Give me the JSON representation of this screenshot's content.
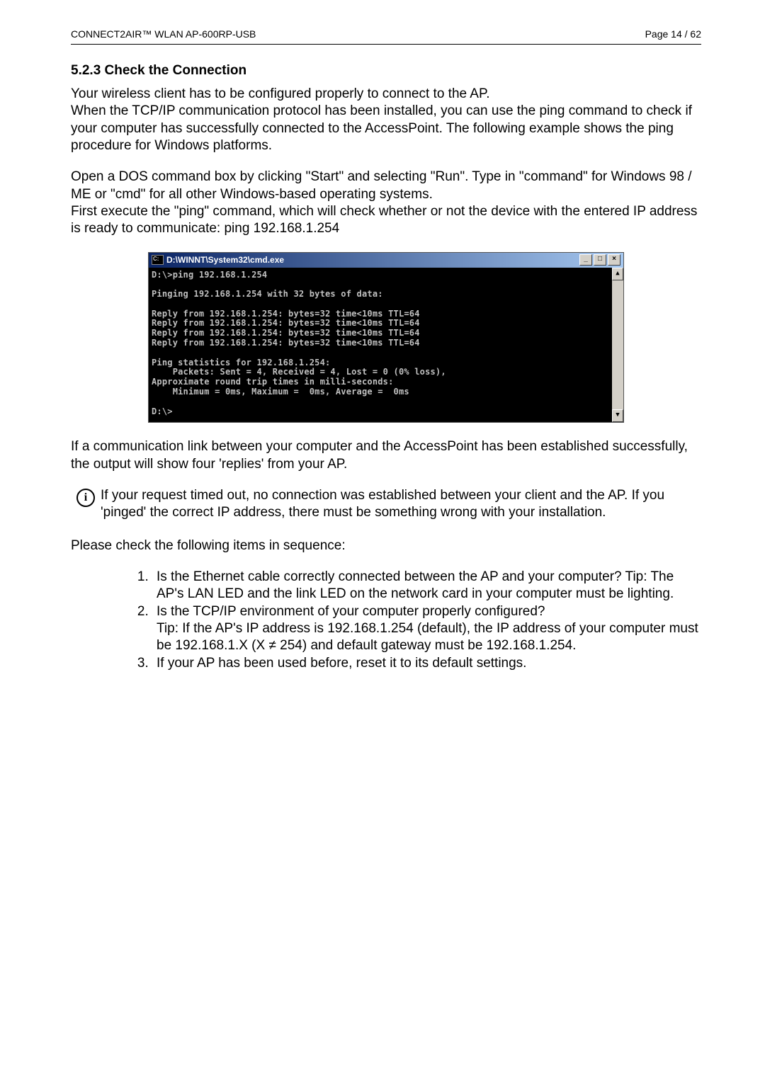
{
  "header": {
    "left": "CONNECT2AIR™ WLAN AP-600RP-USB",
    "right": "Page 14 / 62"
  },
  "section": {
    "heading": "5.2.3  Check the Connection",
    "para1": "Your wireless client has to be configured properly to connect to the AP.\nWhen the TCP/IP communication protocol has been installed, you can use the ping command to check if your computer has successfully connected to the AccessPoint. The following example shows the ping procedure for Windows platforms.",
    "para2": "Open a DOS command box by clicking \"Start\" and selecting \"Run\". Type in \"command\" for Windows 98 / ME or \"cmd\" for all other Windows-based operating systems.\nFirst execute the \"ping\" command, which will check whether or not the device with the entered IP address is ready to communicate: ping 192.168.1.254"
  },
  "cmd": {
    "title": "D:\\WINNT\\System32\\cmd.exe",
    "body": "D:\\>ping 192.168.1.254\n\nPinging 192.168.1.254 with 32 bytes of data:\n\nReply from 192.168.1.254: bytes=32 time<10ms TTL=64\nReply from 192.168.1.254: bytes=32 time<10ms TTL=64\nReply from 192.168.1.254: bytes=32 time<10ms TTL=64\nReply from 192.168.1.254: bytes=32 time<10ms TTL=64\n\nPing statistics for 192.168.1.254:\n    Packets: Sent = 4, Received = 4, Lost = 0 (0% loss),\nApproximate round trip times in milli-seconds:\n    Minimum = 0ms, Maximum =  0ms, Average =  0ms\n\nD:\\>"
  },
  "after_cmd": {
    "para": "If a communication link between your computer and the AccessPoint has been established successfully, the output will show four 'replies' from your AP."
  },
  "info": {
    "text": "If your request timed out, no connection was established between your client and the AP. If you 'pinged' the correct IP address, there must be something wrong with your installation."
  },
  "checklist": {
    "intro": "Please check the following items in sequence:",
    "items": [
      "Is the Ethernet cable correctly connected between the AP and your computer? Tip: The AP's LAN LED and the link LED on the network card in your computer must be lighting.",
      "Is the TCP/IP environment of your computer properly configured?\nTip: If the AP's IP address is 192.168.1.254 (default), the IP address of your computer must be 192.168.1.X (X ≠ 254) and default gateway must be 192.168.1.254.",
      "If your AP has been used before, reset it to its default settings."
    ]
  }
}
